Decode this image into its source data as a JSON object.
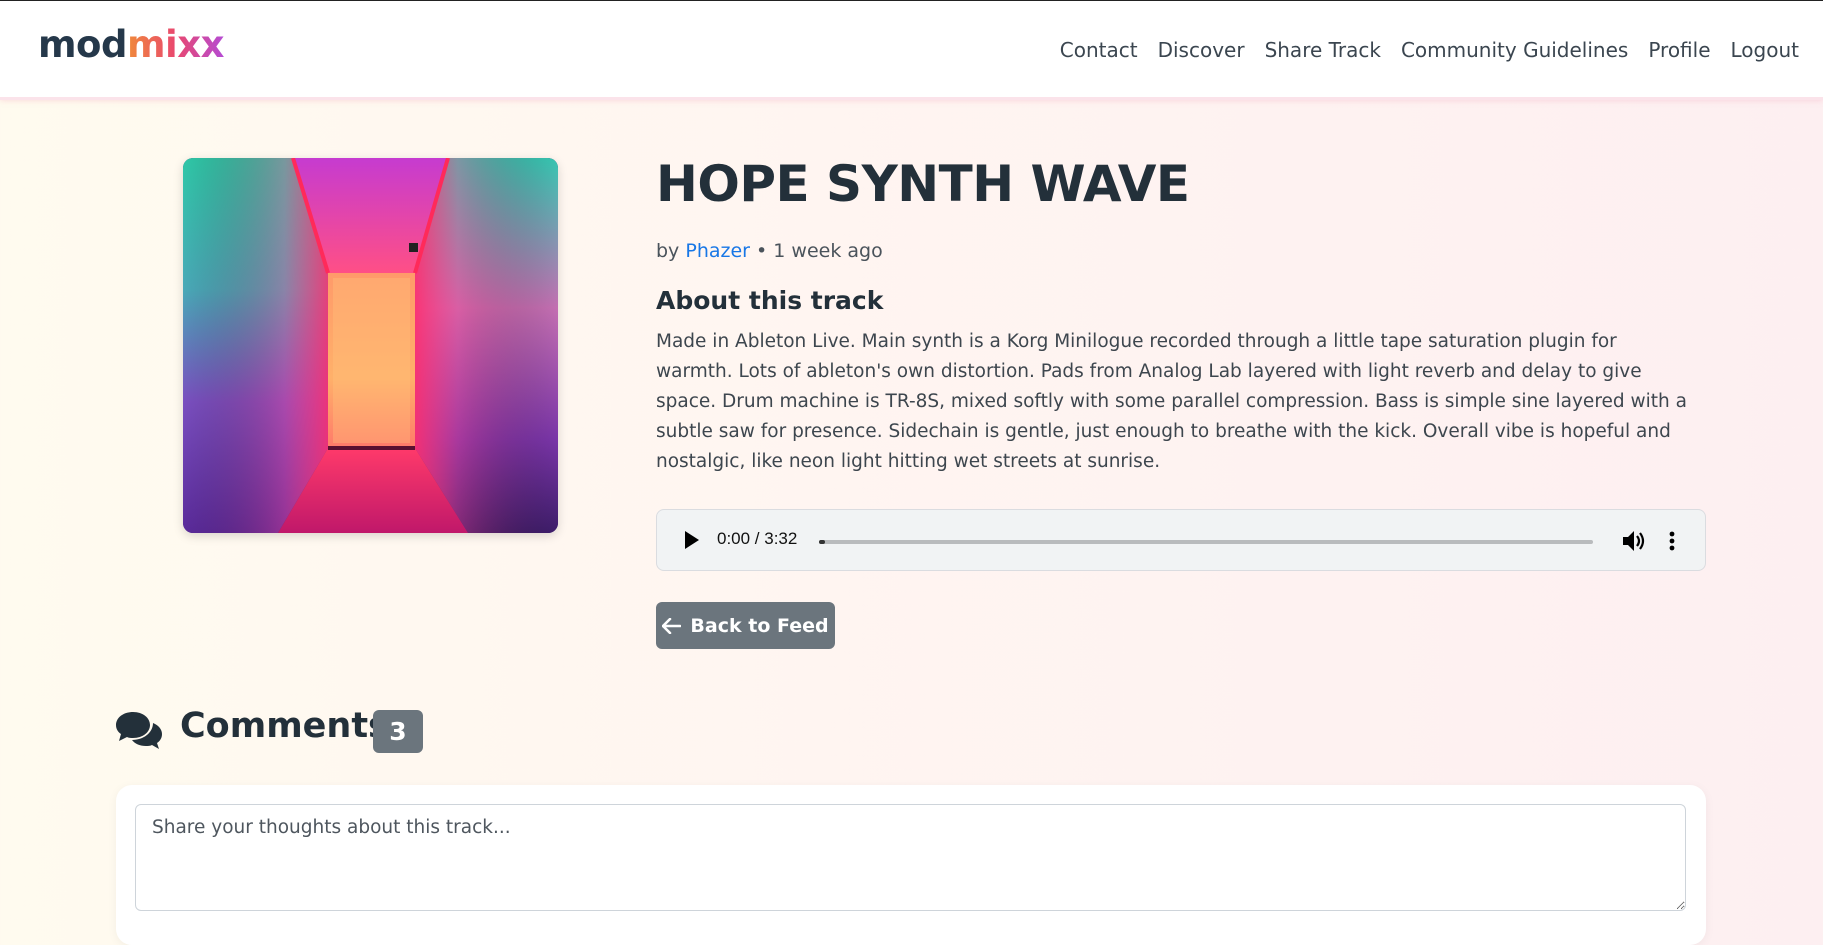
{
  "app": {
    "logo_part1": "mod",
    "logo_part2": "mixx"
  },
  "nav": {
    "items": [
      "Contact",
      "Discover",
      "Share Track",
      "Community Guidelines",
      "Profile",
      "Logout"
    ]
  },
  "track": {
    "title": "HOPE SYNTH WAVE",
    "by_prefix": "by",
    "artist": "Phazer",
    "separator": "•",
    "posted": "1 week ago",
    "about_heading": "About this track",
    "description": "Made in Ableton Live. Main synth is a Korg Minilogue recorded through a little tape saturation plugin for warmth. Lots of ableton's own distortion. Pads from Analog Lab layered with light reverb and delay to give space. Drum machine is TR-8S, mixed softly with some parallel compression. Bass is simple sine layered with a subtle saw for presence. Sidechain is gentle, just enough to breathe with the kick. Overall vibe is hopeful and nostalgic, like neon light hitting wet streets at sunrise.",
    "cover_icon": "neon-corridor-artwork"
  },
  "player": {
    "time": "0:00 / 3:32",
    "progress": 0.0,
    "play_icon": "play-icon",
    "volume_icon": "volume-icon",
    "more_icon": "more-vertical-icon"
  },
  "actions": {
    "back_label": "Back to Feed",
    "back_icon": "arrow-left-icon"
  },
  "comments": {
    "heading": "Comments",
    "count": "3",
    "icon": "comments-icon",
    "placeholder": "Share your thoughts about this track..."
  },
  "colors": {
    "accent_link": "#1877e6",
    "button_gray": "#6b757d",
    "text_dark": "#23303a"
  }
}
